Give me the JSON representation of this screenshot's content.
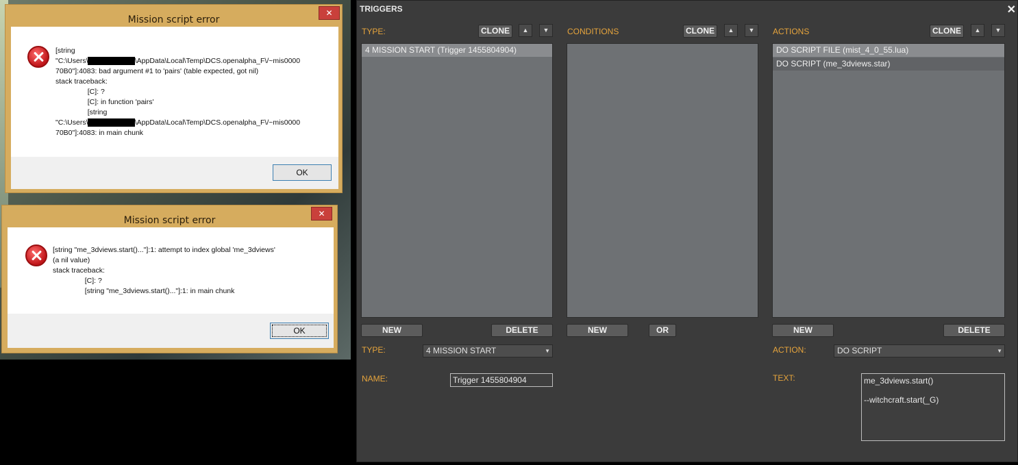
{
  "dialog1": {
    "title": "Mission script error",
    "close_label": "✕",
    "lines": [
      "[string",
      "\"C:\\Users\\",
      "\\AppData\\Local\\Temp\\DCS.openalpha_F\\/~mis0000",
      "70B0\"]:4083: bad argument #1 to 'pairs' (table expected, got nil)",
      "stack traceback:",
      "[C]: ?",
      "[C]: in function 'pairs'",
      "[string",
      "\"C:\\Users\\",
      "\\AppData\\Local\\Temp\\DCS.openalpha_F\\/~mis0000",
      "70B0\"]:4083: in main chunk"
    ],
    "ok_label": "OK"
  },
  "dialog2": {
    "title": "Mission script error",
    "close_label": "✕",
    "lines": [
      "[string \"me_3dviews.start()...\"]:1: attempt to index global 'me_3dviews'",
      "(a nil value)",
      "stack traceback:",
      "[C]: ?",
      "[string \"me_3dviews.start()...\"]:1: in main chunk"
    ],
    "ok_label": "OK"
  },
  "triggers": {
    "title": "TRIGGERS",
    "close_label": "✕",
    "type_section": {
      "label": "TYPE:",
      "clone_label": "CLONE",
      "items": [
        "4 MISSION START (Trigger 1455804904)"
      ],
      "new_label": "NEW",
      "delete_label": "DELETE"
    },
    "conditions_section": {
      "label": "CONDITIONS",
      "clone_label": "CLONE",
      "items": [],
      "new_label": "NEW",
      "or_label": "OR"
    },
    "actions_section": {
      "label": "ACTIONS",
      "clone_label": "CLONE",
      "items": [
        "DO SCRIPT FILE (mist_4_0_55.lua)",
        "DO SCRIPT (me_3dviews.star)"
      ],
      "new_label": "NEW",
      "delete_label": "DELETE"
    },
    "up_arrow": "▲",
    "down_arrow": "▼",
    "type_field": {
      "label": "TYPE:",
      "value": "4 MISSION START"
    },
    "name_field": {
      "label": "NAME:",
      "value": "Trigger 1455804904"
    },
    "action_field": {
      "label": "ACTION:",
      "value": "DO SCRIPT"
    },
    "text_field": {
      "label": "TEXT:",
      "value": "me_3dviews.start()\n\n--witchcraft.start(_G)"
    }
  }
}
